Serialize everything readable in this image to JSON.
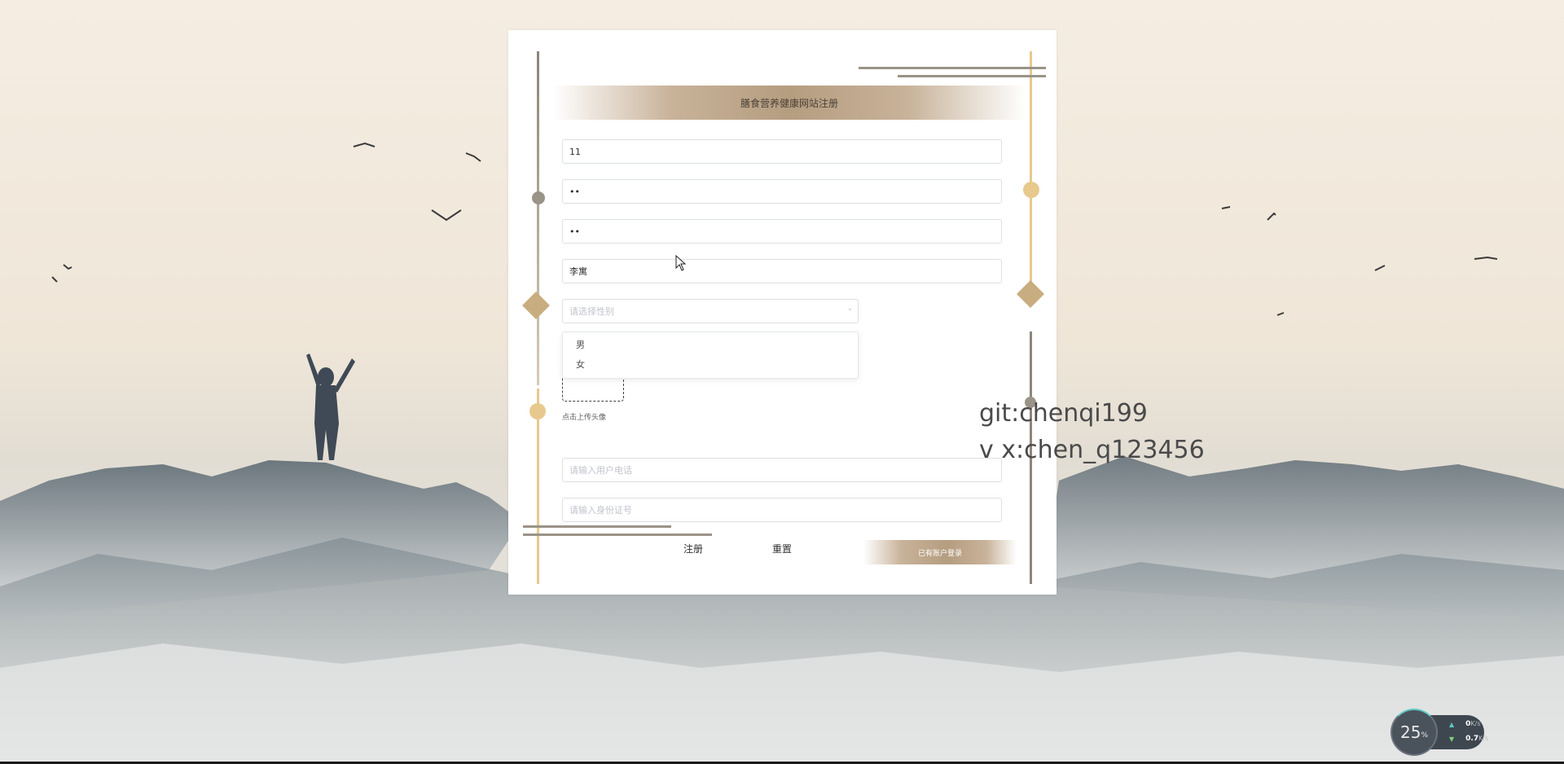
{
  "form": {
    "title": "膳食营养健康网站注册",
    "username_value": "11",
    "password_value": "••",
    "confirm_password_value": "••",
    "name_value": "李寓",
    "gender_placeholder": "请选择性别",
    "gender_options": [
      "男",
      "女"
    ],
    "upload_tip": "点击上传头像",
    "phone_placeholder": "请输入用户电话",
    "idcard_placeholder": "请输入身份证号",
    "register_label": "注册",
    "reset_label": "重置",
    "login_label": "已有账户登录"
  },
  "watermark": {
    "line1": "git:chenqi199",
    "line2": "v x:chen_q123456"
  },
  "speed_widget": {
    "cpu_percent": "25",
    "percent_sign": "%",
    "upload_value": "0",
    "upload_unit": "K/s",
    "download_value": "0.7",
    "download_unit": "K/s"
  },
  "colors": {
    "accent_gold": "#b59d80",
    "accent_light_gold": "#e7c98d",
    "accent_gray": "#9a9388"
  },
  "icons": {
    "gender_caret": "chevron-down-icon",
    "cursor": "mouse-pointer-icon",
    "upload_arrow": "arrow-up-icon",
    "download_arrow": "arrow-down-icon"
  }
}
